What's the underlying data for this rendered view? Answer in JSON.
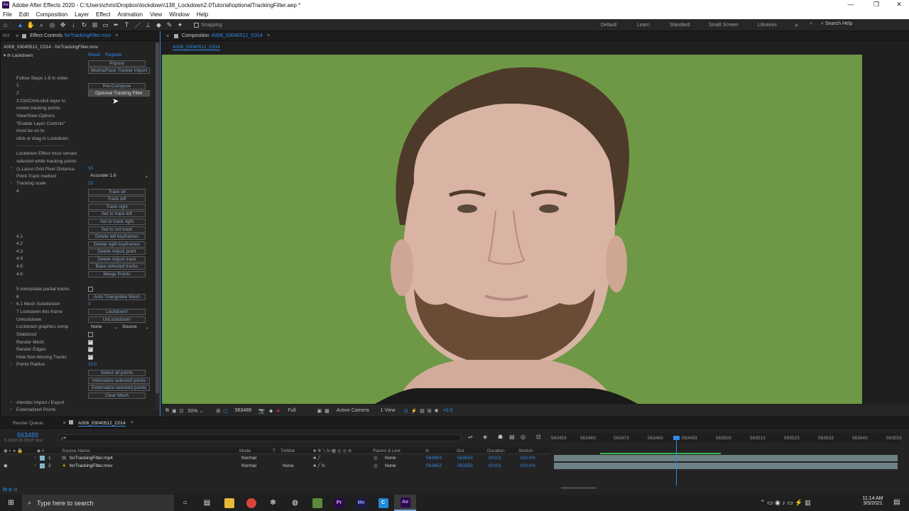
{
  "window": {
    "title": "Adobe After Effects 2020 - C:\\Users\\chris\\Dropbox\\lockdown\\138_Lockdown2.0Tutorial\\optionalTrackingFilter.aep *",
    "logo": "Ae",
    "minimize": "—",
    "maximize": "❐",
    "close": "✕"
  },
  "menu": [
    "File",
    "Edit",
    "Composition",
    "Layer",
    "Effect",
    "Animation",
    "View",
    "Window",
    "Help"
  ],
  "toolbar": {
    "snapping": "Snapping",
    "workspaces": [
      "Default",
      "Learn",
      "Standard",
      "Small Screen",
      "Libraries"
    ],
    "more": "»",
    "search": "Search Help"
  },
  "effect_panel": {
    "tab_prefix": "ect",
    "tab_label": "Effect Controls",
    "tab_file": "forTrackingFilter.mov",
    "breadcrumb": "A008_03040512_C014 - forTrackingFilter.mov",
    "fx": "fx",
    "effect_name": "Lockdown",
    "reset": "Reset",
    "register": "Register",
    "buttons": {
      "popout": "Popout",
      "mocha": "Mocha/Face Tracker Import",
      "precompose": "Pre-Compose",
      "optional": "Optional Tracking Filter",
      "track_all": "Track all",
      "track_left": "Track left",
      "track_right": "Track right",
      "set_left": "Set to track left",
      "set_right": "Set to track right",
      "set_not": "Set to not track",
      "del_left": "Delete left keyframes",
      "del_right": "Delete right keyframes",
      "del_adjust_point": "Delete Adjust point",
      "del_adjust_track": "Delete Adjust track",
      "bake": "Bake selected tracks",
      "merge": "Merge Points",
      "auto_tri": "Auto Triangulate Mesh",
      "lockdown": "Lockdown!",
      "unlockdown": "UnLockdown!",
      "select_all": "Select all points",
      "internalize": "Internalize selected points",
      "externalize": "Externalize selected points",
      "clear_mesh": "Clear Mesh"
    },
    "labels": {
      "follow": "Follow Steps 1-8 in order.",
      "s1": "1",
      "s2": "2",
      "s3a": "3 Ctrl/Cmd-click layer to",
      "s3b": "create tracking points.",
      "s3c": "View/View Options",
      "s3d": "\"Enable Layer Controls\"",
      "s3e": "must be on to",
      "s3f": "click or drag in Lockdown.",
      "sep": "-------------------------------",
      "must1": "Lockdown Effect must remain",
      "must2": "selected while tracking points",
      "lasso": "Lasso Grid Pixel Distance",
      "method": "Point Track method",
      "scale": "Tracking scale",
      "s4": "4",
      "s41": "4.1",
      "s42": "4.2",
      "s43": "4.3",
      "s44": "4.4",
      "s45": "4.5",
      "s46": "4.6",
      "s5": "5 Interpolate partial tracks",
      "s6": "6",
      "s61": "6.1 Mesh Subdivision",
      "s7": "7 Lockdown this frame",
      "unlock": "Unlockdown",
      "gfx": "Lockdown graphics comp",
      "stab": "Stabilized",
      "rmesh": "Render Mesh",
      "redges": "Render Edges",
      "hide": "Hide Non-Moving Tracks",
      "radius": "Points Radius",
      "alembic": "Alembic Import / Export",
      "ext": "Externalized Points"
    },
    "values": {
      "lasso": "50",
      "method": "Accurate 1.6",
      "scale": "25",
      "mesh": "0",
      "gfx_none": "None",
      "gfx_source": "Source",
      "radius": "10.0",
      "check": "✓"
    }
  },
  "comp_panel": {
    "tab_label": "Composition",
    "tab_name": "A008_03040512_C014",
    "sub_tab": "A008_03040512_C014",
    "zoom": "50%",
    "timecode": "563489",
    "resolution": "Full",
    "camera": "Active Camera",
    "views": "1 View",
    "exposure": "+0.0"
  },
  "timeline": {
    "render_queue": "Render Queue",
    "comp_tab": "A008_03040512_C014",
    "timecode": "563489",
    "subtime": "5:13:02:29 (29.97 fps)",
    "search_placeholder": "ρ▾",
    "columns": {
      "source": "Source Name",
      "mode": "Mode",
      "t": "T",
      "trkmat": "TrkMat",
      "parent": "Parent & Link",
      "in": "In",
      "out": "Out",
      "duration": "Duration",
      "stretch": "Stretch"
    },
    "ruler": [
      "563453",
      "563463",
      "563473",
      "563483",
      "563493",
      "563503",
      "563513",
      "563523",
      "563533",
      "563543",
      "563553"
    ],
    "layers": [
      {
        "num": "1",
        "name": "forTrackingFilter.mp4",
        "mode": "Normal",
        "trkmat": "",
        "parent": "None",
        "in": "563453",
        "out": "563553",
        "duration": "00101",
        "stretch": "100.0%"
      },
      {
        "num": "2",
        "name": "forTrackingFilter.mov",
        "mode": "Normal",
        "trkmat": "None",
        "parent": "None",
        "in": "563453",
        "out": "563553",
        "duration": "00101",
        "stretch": "100.0%"
      }
    ]
  },
  "taskbar": {
    "search": "Type here to search",
    "time": "11:14 AM",
    "date": "3/5/2021",
    "apps": [
      "Pr",
      "Me",
      "C",
      "Ae"
    ]
  },
  "colors": {
    "accent": "#2d8ceb",
    "greenscreen": "#6e9846"
  }
}
